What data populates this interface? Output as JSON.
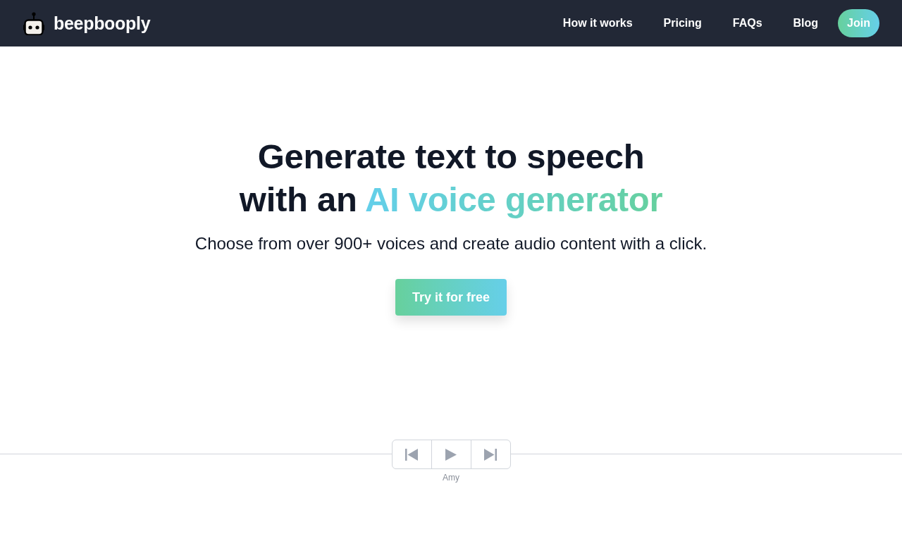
{
  "brand": {
    "name": "beepbooply"
  },
  "nav": {
    "links": [
      "How it works",
      "Pricing",
      "FAQs",
      "Blog"
    ],
    "join_button": "Join"
  },
  "hero": {
    "headline": {
      "line_1": "Generate text to speech",
      "line_2": "with an",
      "highlight": "AI voice generator"
    },
    "subtitle": "Choose from over 900+ voices and create audio content with a click.",
    "cta_button": "Try it for free"
  },
  "player": {
    "controls": [
      {
        "kind": "previous"
      },
      {
        "kind": "play"
      },
      {
        "kind": "next"
      }
    ],
    "voice": "Amy"
  }
}
